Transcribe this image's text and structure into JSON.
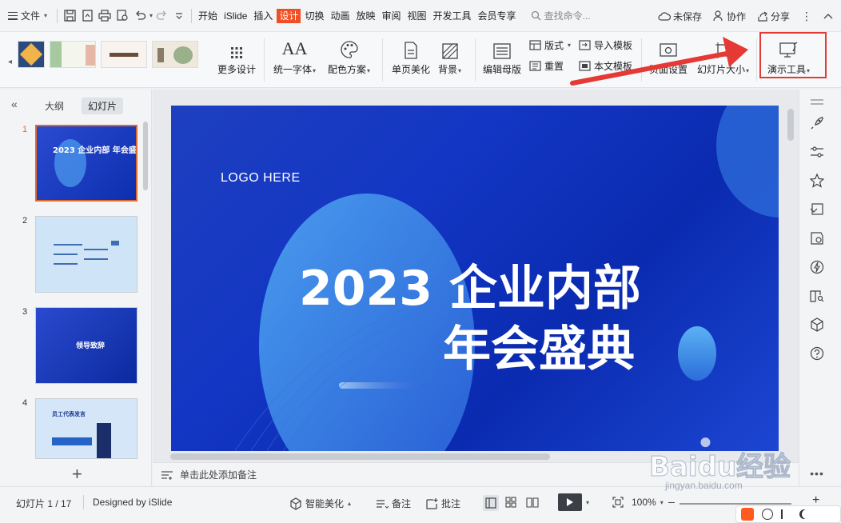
{
  "menubar": {
    "file_label": "文件",
    "tabs": [
      "开始",
      "iSlide",
      "插入",
      "设计",
      "切换",
      "动画",
      "放映",
      "审阅",
      "视图",
      "开发工具",
      "会员专享"
    ],
    "active_tab": "设计",
    "search_placeholder": "查找命令...",
    "unsaved_label": "未保存",
    "collab_label": "协作",
    "share_label": "分享"
  },
  "ribbon": {
    "more_design": "更多设计",
    "unify_font": "统一字体",
    "color_scheme": "配色方案",
    "page_beautify": "单页美化",
    "background": "背景",
    "edit_master": "编辑母版",
    "layout": "版式",
    "reset": "重置",
    "import_template": "导入模板",
    "this_template": "本文模板",
    "page_setup": "页面设置",
    "slide_size": "幻灯片大小",
    "present_tools": "演示工具"
  },
  "leftpanel": {
    "outline_tab": "大纲",
    "slides_tab": "幻灯片",
    "slides": [
      {
        "num": "1"
      },
      {
        "num": "2"
      },
      {
        "num": "3"
      },
      {
        "num": "4"
      }
    ],
    "thumb1_title": "2023 企业内部 年会盛典",
    "thumb3_title": "领导致辞",
    "thumb4_title": "员工代表发言"
  },
  "slide": {
    "logo_text": "LOGO HERE",
    "title_line1": "2023 企业内部",
    "title_line2": "年会盛典"
  },
  "notes": {
    "placeholder": "单击此处添加备注"
  },
  "status": {
    "slide_count": "幻灯片 1 / 17",
    "designer": "Designed by iSlide",
    "smart_beautify": "智能美化",
    "notes_label": "备注",
    "comments_label": "批注",
    "zoom": "100%"
  },
  "watermark": {
    "text": "Baidu经验",
    "url_text": "jingyan.baidu.com"
  },
  "colors": {
    "accent": "#f04e23",
    "highlight": "#e53935",
    "slide_blue": "#1336c4"
  }
}
